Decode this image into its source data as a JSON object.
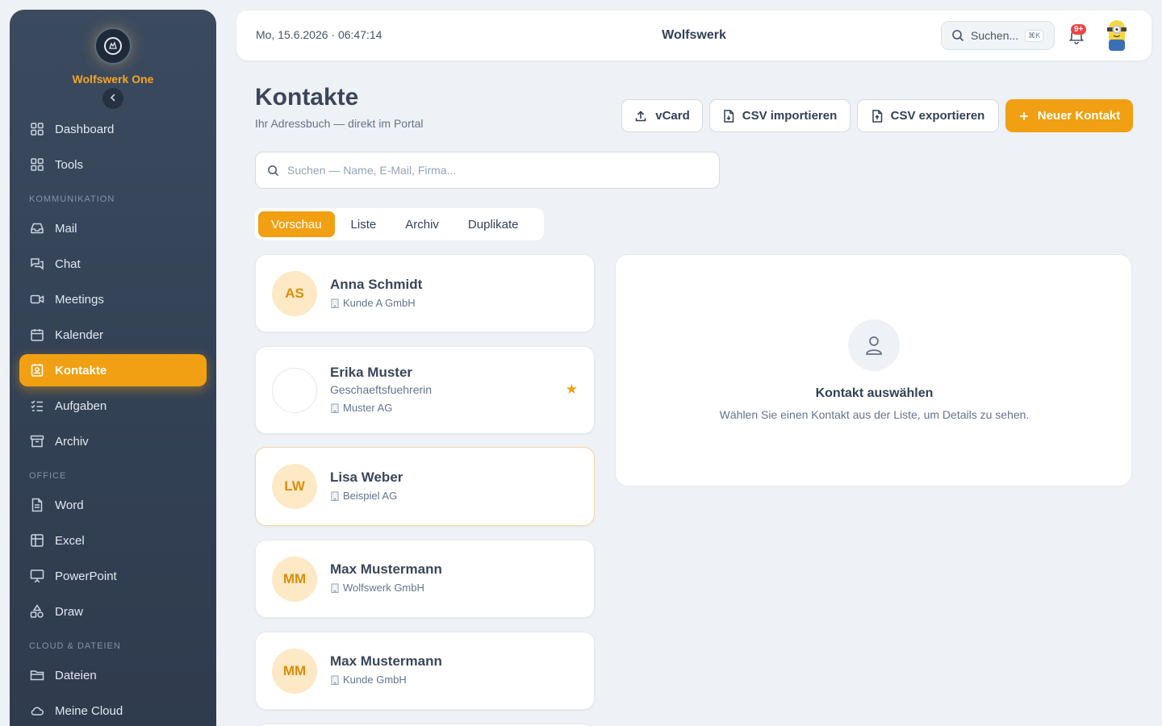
{
  "sidebar": {
    "brand": "Wolfswerk One",
    "items": [
      {
        "label": "Dashboard"
      },
      {
        "label": "Tools"
      },
      {
        "label": "Mail"
      },
      {
        "label": "Chat"
      },
      {
        "label": "Meetings"
      },
      {
        "label": "Kalender"
      },
      {
        "label": "Kontakte"
      },
      {
        "label": "Aufgaben"
      },
      {
        "label": "Archiv"
      },
      {
        "label": "Word"
      },
      {
        "label": "Excel"
      },
      {
        "label": "PowerPoint"
      },
      {
        "label": "Draw"
      },
      {
        "label": "Dateien"
      },
      {
        "label": "Meine Cloud"
      }
    ],
    "sections": [
      "KOMMUNIKATION",
      "OFFICE",
      "CLOUD & DATEIEN"
    ],
    "active_item": "Kontakte"
  },
  "topbar": {
    "datetime": "Mo, 15.6.2026 · 06:47:14",
    "title": "Wolfswerk",
    "search_label": "Suchen...",
    "search_shortcut": "⌘K",
    "notification_badge": "9+"
  },
  "page": {
    "title": "Kontakte",
    "subtitle": "Ihr Adressbuch — direkt im Portal",
    "buttons": {
      "vcard": "vCard",
      "csv_import": "CSV importieren",
      "csv_export": "CSV exportieren",
      "new_contact": "Neuer Kontakt"
    },
    "search_placeholder": "Suchen — Name, E-Mail, Firma...",
    "tabs": [
      "Vorschau",
      "Liste",
      "Archiv",
      "Duplikate"
    ],
    "active_tab": "Vorschau"
  },
  "contacts": [
    {
      "initials": "AS",
      "name": "Anna Schmidt",
      "role": "",
      "company": "Kunde A GmbH",
      "favorite": false
    },
    {
      "initials": "",
      "name": "Erika Muster",
      "role": "Geschaeftsfuehrerin",
      "company": "Muster AG",
      "favorite": true
    },
    {
      "initials": "LW",
      "name": "Lisa Weber",
      "role": "",
      "company": "Beispiel AG",
      "favorite": false
    },
    {
      "initials": "MM",
      "name": "Max Mustermann",
      "role": "",
      "company": "Wolfswerk GmbH",
      "favorite": false
    },
    {
      "initials": "MM",
      "name": "Max Mustermann",
      "role": "",
      "company": "Kunde GmbH",
      "favorite": false
    }
  ],
  "detail": {
    "title": "Kontakt auswählen",
    "text": "Wählen Sie einen Kontakt aus der Liste, um Details zu sehen."
  },
  "colors": {
    "accent": "#f0a012",
    "sidebar": "#334155",
    "background": "#eef1f5",
    "badge": "#ef4444"
  }
}
